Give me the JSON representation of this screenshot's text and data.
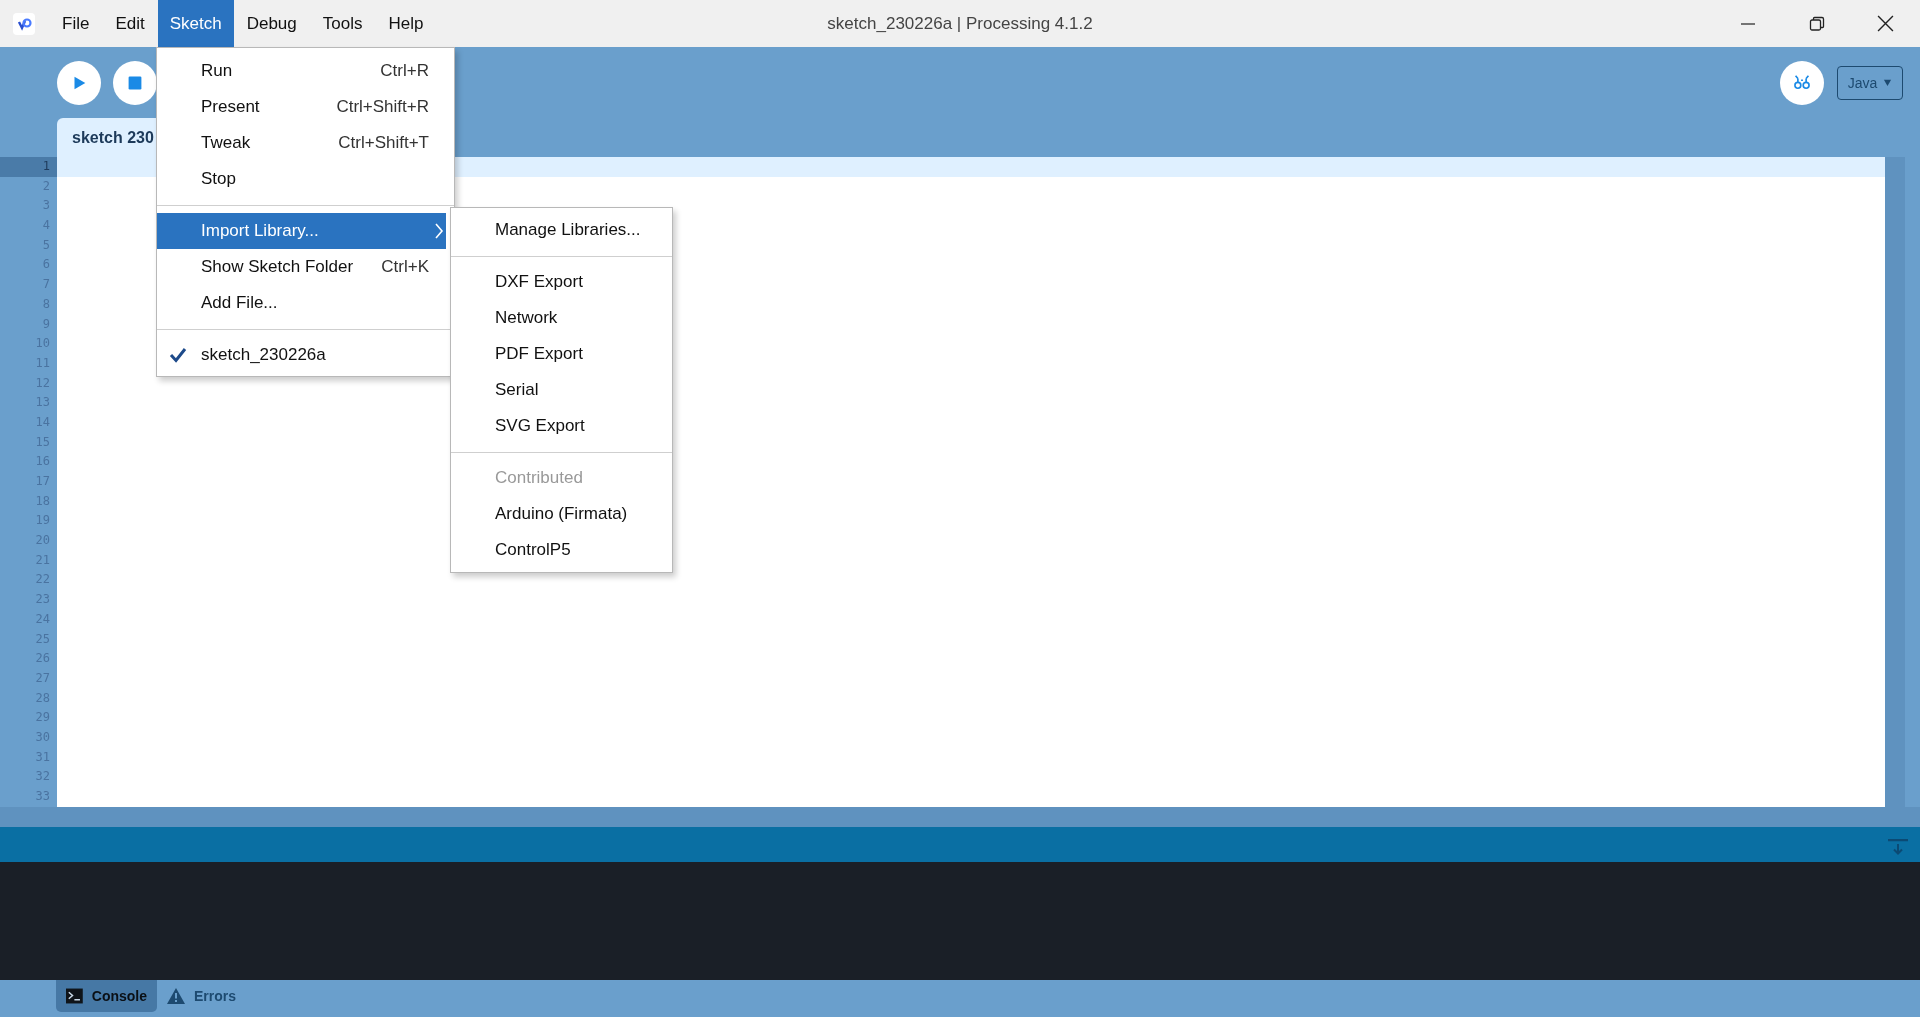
{
  "window": {
    "title": "sketch_230226a | Processing 4.1.2"
  },
  "menu_bar": [
    {
      "label": "File",
      "selected": false
    },
    {
      "label": "Edit",
      "selected": false
    },
    {
      "label": "Sketch",
      "selected": true
    },
    {
      "label": "Debug",
      "selected": false
    },
    {
      "label": "Tools",
      "selected": false
    },
    {
      "label": "Help",
      "selected": false
    }
  ],
  "toolbar": {
    "mode": "Java"
  },
  "tabs": [
    {
      "label": "sketch 230",
      "selected": true
    }
  ],
  "editor": {
    "line_numbers": [
      {
        "number": "1",
        "current": true
      },
      {
        "number": "2",
        "current": false
      },
      {
        "number": "3",
        "current": false
      },
      {
        "number": "4",
        "current": false
      },
      {
        "number": "5",
        "current": false
      },
      {
        "number": "6",
        "current": false
      },
      {
        "number": "7",
        "current": false
      },
      {
        "number": "8",
        "current": false
      },
      {
        "number": "9",
        "current": false
      },
      {
        "number": "10",
        "current": false
      },
      {
        "number": "11",
        "current": false
      },
      {
        "number": "12",
        "current": false
      },
      {
        "number": "13",
        "current": false
      },
      {
        "number": "14",
        "current": false
      },
      {
        "number": "15",
        "current": false
      },
      {
        "number": "16",
        "current": false
      },
      {
        "number": "17",
        "current": false
      },
      {
        "number": "18",
        "current": false
      },
      {
        "number": "19",
        "current": false
      },
      {
        "number": "20",
        "current": false
      },
      {
        "number": "21",
        "current": false
      },
      {
        "number": "22",
        "current": false
      },
      {
        "number": "23",
        "current": false
      },
      {
        "number": "24",
        "current": false
      },
      {
        "number": "25",
        "current": false
      },
      {
        "number": "26",
        "current": false
      },
      {
        "number": "27",
        "current": false
      },
      {
        "number": "28",
        "current": false
      },
      {
        "number": "29",
        "current": false
      },
      {
        "number": "30",
        "current": false
      },
      {
        "number": "31",
        "current": false
      },
      {
        "number": "32",
        "current": false
      },
      {
        "number": "33",
        "current": false
      }
    ]
  },
  "console_tabs": [
    {
      "label": "Console",
      "selected": true,
      "kind": "console"
    },
    {
      "label": "Errors",
      "selected": false,
      "kind": "errors"
    }
  ],
  "sketch_menu": {
    "items": [
      {
        "kind": "item",
        "label": "Run",
        "shortcut": "Ctrl+R",
        "selected": false
      },
      {
        "kind": "item",
        "label": "Present",
        "shortcut": "Ctrl+Shift+R",
        "selected": false
      },
      {
        "kind": "item",
        "label": "Tweak",
        "shortcut": "Ctrl+Shift+T",
        "selected": false
      },
      {
        "kind": "item",
        "label": "Stop",
        "selected": false
      },
      {
        "kind": "separator"
      },
      {
        "kind": "submenu",
        "label": "Import Library...",
        "selected": true
      },
      {
        "kind": "item",
        "label": "Show Sketch Folder",
        "shortcut": "Ctrl+K",
        "selected": false
      },
      {
        "kind": "item",
        "label": "Add File...",
        "selected": false
      },
      {
        "kind": "separator"
      },
      {
        "kind": "check",
        "label": "sketch_230226a",
        "checked": true,
        "selected": false
      }
    ]
  },
  "library_submenu": {
    "items": [
      {
        "kind": "item",
        "label": "Manage Libraries..."
      },
      {
        "kind": "separator"
      },
      {
        "kind": "item",
        "label": "DXF Export"
      },
      {
        "kind": "item",
        "label": "Network"
      },
      {
        "kind": "item",
        "label": "PDF Export"
      },
      {
        "kind": "item",
        "label": "Serial"
      },
      {
        "kind": "item",
        "label": "SVG Export"
      },
      {
        "kind": "separator"
      },
      {
        "kind": "header",
        "label": "Contributed"
      },
      {
        "kind": "item",
        "label": "Arduino (Firmata)"
      },
      {
        "kind": "item",
        "label": "ControlP5"
      }
    ]
  }
}
